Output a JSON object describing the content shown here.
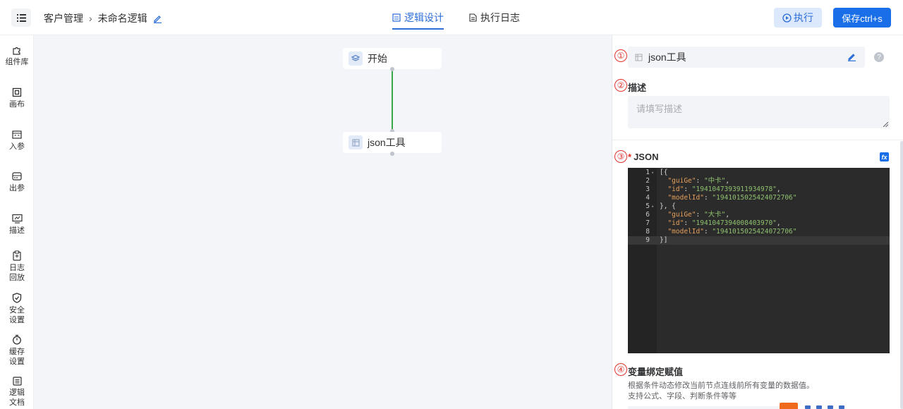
{
  "header": {
    "menu_icon": "list-icon",
    "breadcrumb": {
      "parent": "客户管理",
      "current": "未命名逻辑"
    },
    "tabs": [
      {
        "label": "逻辑设计",
        "icon": "design-icon",
        "active": true
      },
      {
        "label": "执行日志",
        "icon": "document-icon",
        "active": false
      }
    ],
    "run_label": "执行",
    "save_label": "保存ctrl+s"
  },
  "sidebar": {
    "items": [
      {
        "label": "组件库",
        "icon": "puzzle-icon"
      },
      {
        "label": "画布",
        "icon": "canvas-icon"
      },
      {
        "label": "入参",
        "icon": "input-param-icon"
      },
      {
        "label": "出参",
        "icon": "output-param-icon"
      },
      {
        "label": "描述",
        "icon": "description-icon"
      },
      {
        "label": "日志回放",
        "icon": "clipboard-icon"
      },
      {
        "label": "安全设置",
        "icon": "shield-icon"
      },
      {
        "label": "缓存设置",
        "icon": "timer-icon"
      },
      {
        "label": "逻辑文档",
        "icon": "doc-list-icon"
      }
    ]
  },
  "canvas": {
    "nodes": [
      {
        "label": "开始",
        "icon": "layers-icon"
      },
      {
        "label": "json工具",
        "icon": "table-icon"
      }
    ],
    "connector_color": "#3aa64a"
  },
  "panel": {
    "markers": [
      "①",
      "②",
      "③",
      "④"
    ],
    "node_title": "json工具",
    "help": "?",
    "desc_label": "描述",
    "desc_placeholder": "请填写描述",
    "json_required": "*",
    "json_label": "JSON",
    "fx_label": "fx",
    "code_lines": [
      {
        "n": "1",
        "fold": true,
        "text": "[{"
      },
      {
        "n": "2",
        "fold": false,
        "key": "\"guiGe\"",
        "value": "\"中卡\"",
        "tail": ","
      },
      {
        "n": "3",
        "fold": false,
        "key": "\"id\"",
        "value": "\"1941047393911934978\"",
        "tail": ","
      },
      {
        "n": "4",
        "fold": false,
        "key": "\"modelId\"",
        "value": "\"1941015025424072706\"",
        "tail": ""
      },
      {
        "n": "5",
        "fold": true,
        "text": "}, {"
      },
      {
        "n": "6",
        "fold": false,
        "key": "\"guiGe\"",
        "value": "\"大卡\"",
        "tail": ","
      },
      {
        "n": "7",
        "fold": false,
        "key": "\"id\"",
        "value": "\"1941047394008403970\"",
        "tail": ","
      },
      {
        "n": "8",
        "fold": false,
        "key": "\"modelId\"",
        "value": "\"1941015025424072706\"",
        "tail": ""
      },
      {
        "n": "9",
        "fold": false,
        "text": "}]",
        "active": true
      }
    ],
    "binding_label": "变量绑定赋值",
    "binding_desc_1": "根据条件动态修改当前节点连线前所有变量的数据值。",
    "binding_desc_2": "支持公式、字段、判断条件等等"
  },
  "colors": {
    "accent": "#1a6fe8",
    "active_tab": "#2e6fd8",
    "marker_red": "#e0322b",
    "editor_bg": "#2b2b2b",
    "json_key": "#e6a05c",
    "json_string": "#8fc06f"
  }
}
